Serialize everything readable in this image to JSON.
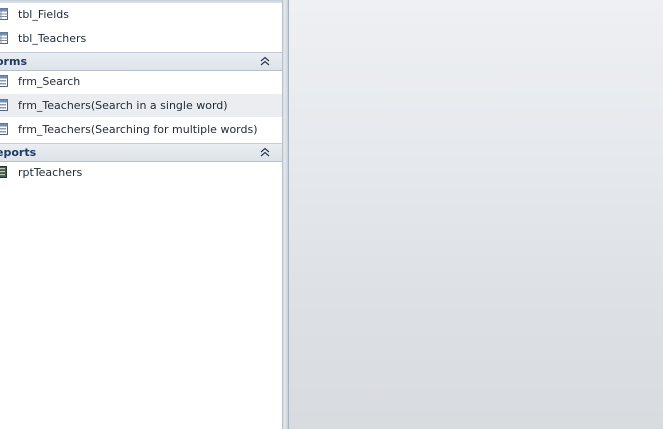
{
  "nav": {
    "tables": [
      {
        "label": "tbl_Fields",
        "icon": "table-icon"
      },
      {
        "label": "tbl_Teachers",
        "icon": "table-icon"
      }
    ],
    "forms_group": {
      "label": "orms",
      "collapse_icon": "double-chevron-up-icon"
    },
    "forms": [
      {
        "label": "frm_Search",
        "icon": "form-icon"
      },
      {
        "label": "frm_Teachers(Search in a single word)",
        "icon": "form-icon"
      },
      {
        "label": "frm_Teachers(Searching for multiple words)",
        "icon": "form-icon"
      }
    ],
    "reports_group": {
      "label": "eports",
      "collapse_icon": "double-chevron-up-icon"
    },
    "reports": [
      {
        "label": "rptTeachers",
        "icon": "report-icon"
      }
    ]
  },
  "colors": {
    "group_header_text": "#1d3b63",
    "workspace_top": "#eef0f3",
    "workspace_bottom": "#d8dbe0",
    "selected_row": "#ebedf0"
  }
}
